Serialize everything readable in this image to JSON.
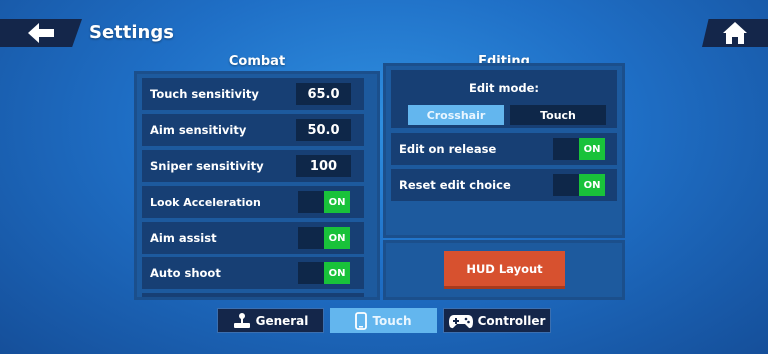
{
  "header": {
    "title": "Settings",
    "back_icon": "arrow-left-icon",
    "home_icon": "home-icon"
  },
  "combat": {
    "title": "Combat",
    "rows": [
      {
        "label": "Touch sensitivity",
        "value": "65.0"
      },
      {
        "label": "Aim sensitivity",
        "value": "50.0"
      },
      {
        "label": "Sniper sensitivity",
        "value": "100"
      },
      {
        "label": "Look Acceleration",
        "state": "ON"
      },
      {
        "label": "Aim assist",
        "state": "ON"
      },
      {
        "label": "Auto shoot",
        "state": "ON"
      }
    ]
  },
  "editing": {
    "title": "Editing",
    "edit_mode_label": "Edit mode:",
    "modes": [
      "Crosshair",
      "Touch"
    ],
    "selected_mode": "Crosshair",
    "rows": [
      {
        "label": "Edit on release",
        "state": "ON"
      },
      {
        "label": "Reset edit choice",
        "state": "ON"
      }
    ],
    "hud_button": "HUD Layout"
  },
  "tabs": [
    {
      "label": "General",
      "icon": "joystick-icon"
    },
    {
      "label": "Touch",
      "icon": "phone-icon",
      "active": true
    },
    {
      "label": "Controller",
      "icon": "gamepad-icon"
    }
  ],
  "colors": {
    "toggle_on": "#19c23a",
    "hud_button": "#d7512f",
    "active_tab": "#63b6ee",
    "dark_row": "#173f74"
  }
}
